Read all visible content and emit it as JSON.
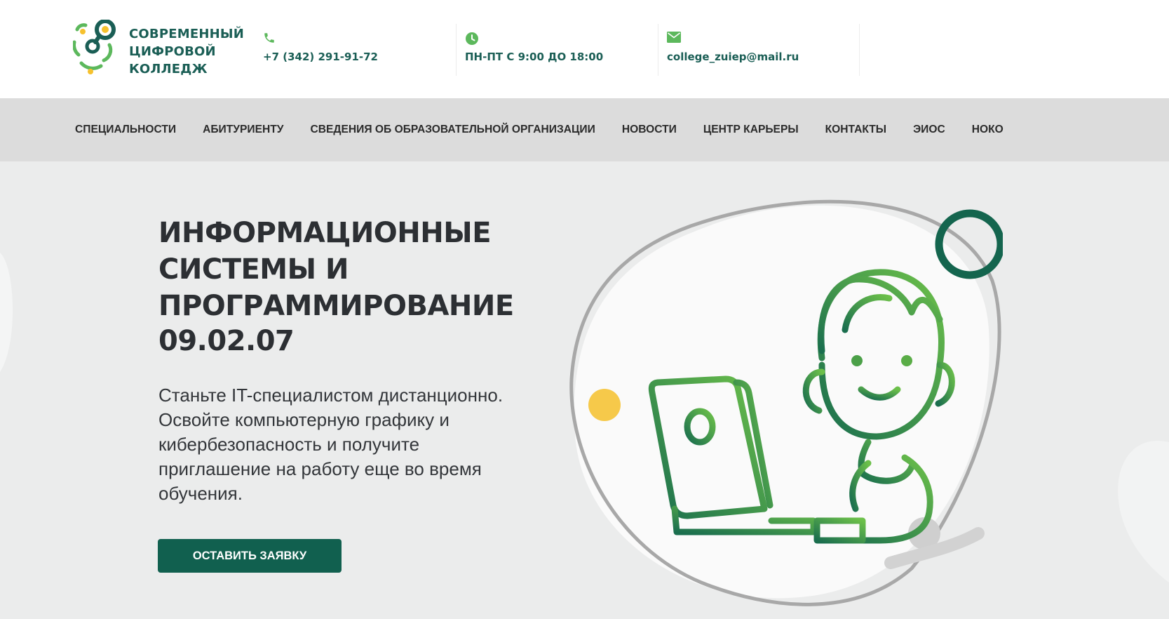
{
  "brand": {
    "name_lines": [
      "СОВРЕМЕННЫЙ",
      "ЦИФРОВОЙ",
      "КОЛЛЕДЖ"
    ],
    "logo_icon": "college-logo-icon",
    "colors": {
      "primary": "#1a5e55",
      "accent_green": "#5cb85c",
      "accent_yellow": "#f6c12e"
    }
  },
  "contacts": {
    "phone": {
      "icon": "phone-icon",
      "text": "+7 (342) 291-91-72"
    },
    "hours": {
      "icon": "clock-icon",
      "text": "ПН-ПТ С 9:00 ДО 18:00"
    },
    "email": {
      "icon": "envelope-icon",
      "text": "college_zuiep@mail.ru"
    }
  },
  "nav": {
    "items": [
      {
        "label": "СПЕЦИАЛЬНОСТИ"
      },
      {
        "label": "АБИТУРИЕНТУ"
      },
      {
        "label": "СВЕДЕНИЯ ОБ ОБРАЗОВАТЕЛЬНОЙ ОРГАНИЗАЦИИ"
      },
      {
        "label": "НОВОСТИ"
      },
      {
        "label": "ЦЕНТР КАРЬЕРЫ"
      },
      {
        "label": "КОНТАКТЫ"
      },
      {
        "label": "ЭИОС"
      },
      {
        "label": "НОКО"
      }
    ]
  },
  "hero": {
    "title_lines": [
      "ИНФОРМАЦИОННЫЕ",
      "СИСТЕМЫ И",
      "ПРОГРАММИРОВАНИЕ"
    ],
    "code": "09.02.07",
    "description_lines": [
      "Станьте IT-специалистом дистанционно.",
      "Освойте компьютерную графику и",
      "кибербезопасность и получите",
      "приглашение на работу еще во время",
      "обучения."
    ],
    "cta_label": "ОСТАВИТЬ ЗАЯВКУ",
    "cta_color": "#11604f",
    "illustration": "student-with-laptop-illustration"
  }
}
